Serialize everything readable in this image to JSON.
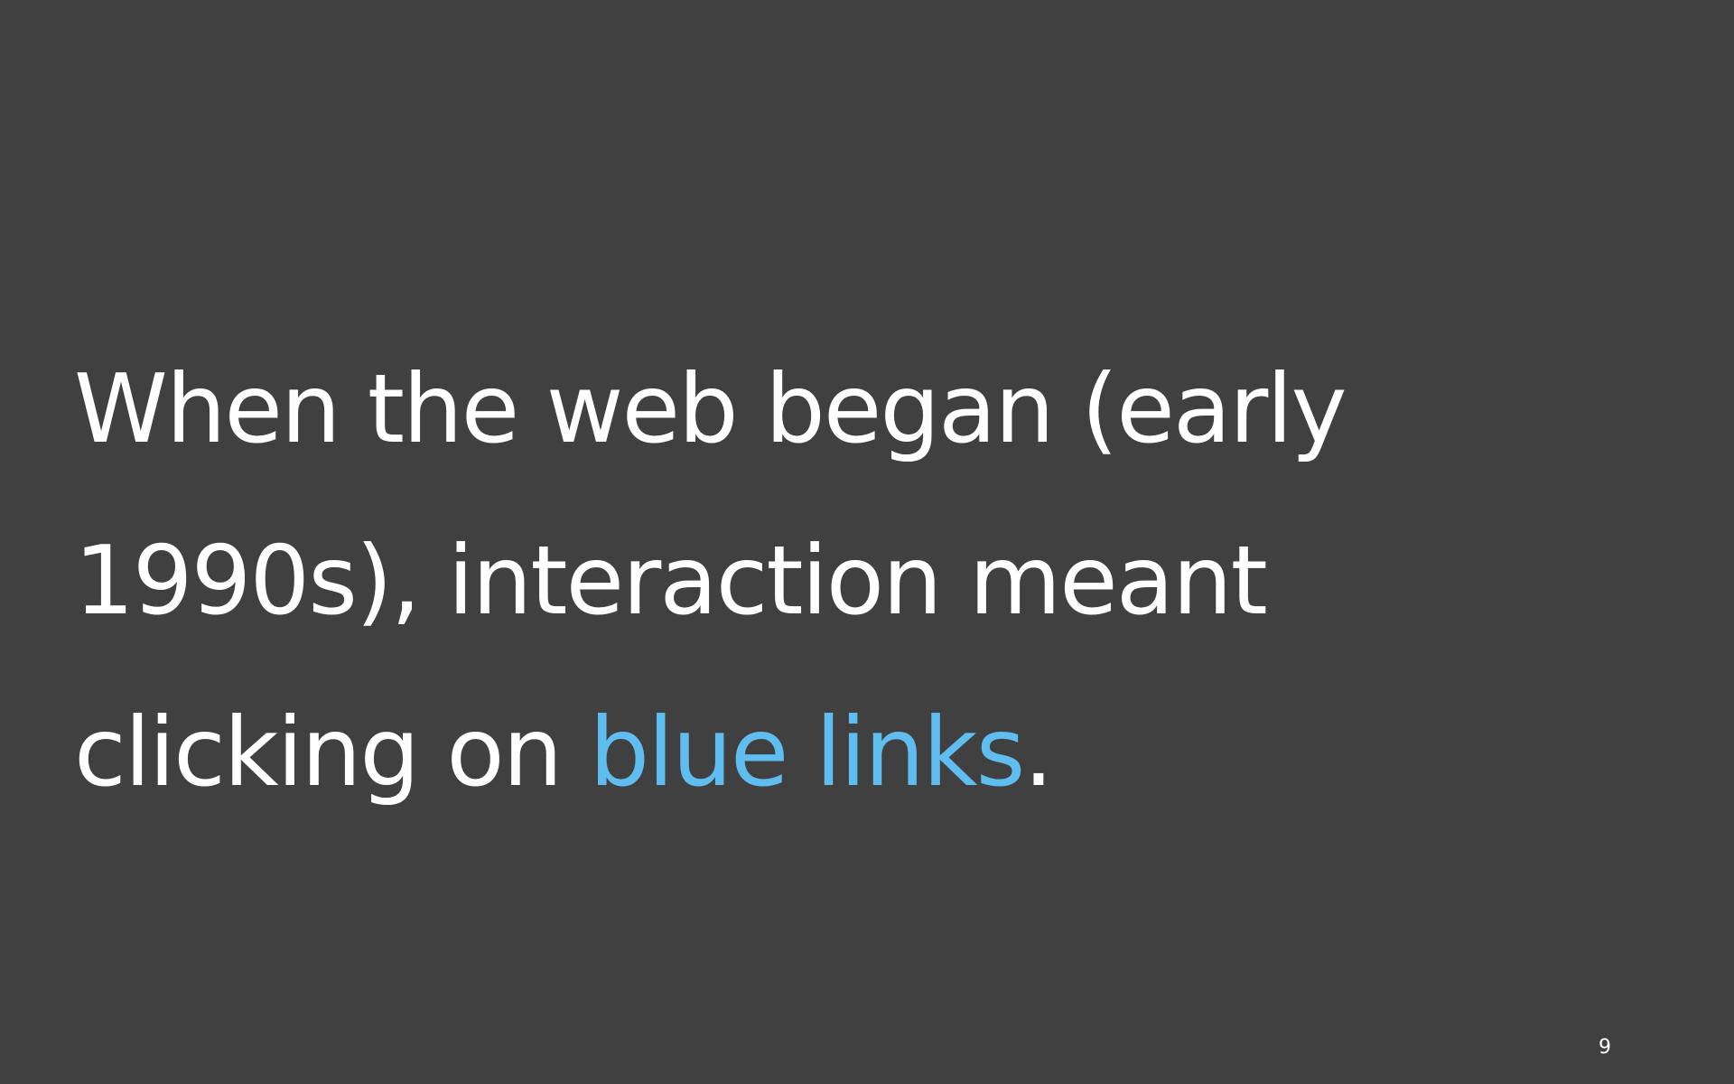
{
  "slide": {
    "background_color": "#404040",
    "text_color": "#ffffff",
    "accent_color": "#5fbdf0",
    "body": {
      "line1": "When the web began (early",
      "line2": "1990s), interaction meant",
      "line3_prefix": "clicking on ",
      "line3_highlight": "blue links",
      "line3_suffix": "."
    },
    "slide_number": "9"
  }
}
